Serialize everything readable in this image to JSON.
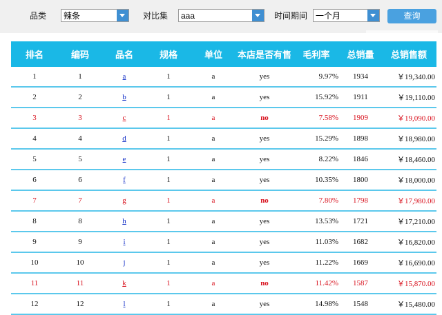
{
  "filters": {
    "category_label": "品类",
    "category_value": "辣条",
    "compare_label": "对比集",
    "compare_value": "aaa",
    "period_label": "时间期间",
    "period_value": "一个月",
    "query_label": "查询"
  },
  "table": {
    "headers": [
      "排名",
      "编码",
      "品名",
      "规格",
      "单位",
      "本店是否有售",
      "毛利率",
      "总销量",
      "总销售额"
    ],
    "rows": [
      {
        "rank": "1",
        "code": "1",
        "name": "a",
        "spec": "1",
        "unit": "a",
        "sale": "yes",
        "margin": "9.97%",
        "qty": "1934",
        "amount": "￥19,340.00",
        "warn": false
      },
      {
        "rank": "2",
        "code": "2",
        "name": "b",
        "spec": "1",
        "unit": "a",
        "sale": "yes",
        "margin": "15.92%",
        "qty": "1911",
        "amount": "￥19,110.00",
        "warn": false
      },
      {
        "rank": "3",
        "code": "3",
        "name": "c",
        "spec": "1",
        "unit": "a",
        "sale": "no",
        "margin": "7.58%",
        "qty": "1909",
        "amount": "￥19,090.00",
        "warn": true
      },
      {
        "rank": "4",
        "code": "4",
        "name": "d",
        "spec": "1",
        "unit": "a",
        "sale": "yes",
        "margin": "15.29%",
        "qty": "1898",
        "amount": "￥18,980.00",
        "warn": false
      },
      {
        "rank": "5",
        "code": "5",
        "name": "e",
        "spec": "1",
        "unit": "a",
        "sale": "yes",
        "margin": "8.22%",
        "qty": "1846",
        "amount": "￥18,460.00",
        "warn": false
      },
      {
        "rank": "6",
        "code": "6",
        "name": "f",
        "spec": "1",
        "unit": "a",
        "sale": "yes",
        "margin": "10.35%",
        "qty": "1800",
        "amount": "￥18,000.00",
        "warn": false
      },
      {
        "rank": "7",
        "code": "7",
        "name": "g",
        "spec": "1",
        "unit": "a",
        "sale": "no",
        "margin": "7.80%",
        "qty": "1798",
        "amount": "￥17,980.00",
        "warn": true
      },
      {
        "rank": "8",
        "code": "8",
        "name": "h",
        "spec": "1",
        "unit": "a",
        "sale": "yes",
        "margin": "13.53%",
        "qty": "1721",
        "amount": "￥17,210.00",
        "warn": false
      },
      {
        "rank": "9",
        "code": "9",
        "name": "i",
        "spec": "1",
        "unit": "a",
        "sale": "yes",
        "margin": "11.03%",
        "qty": "1682",
        "amount": "￥16,820.00",
        "warn": false
      },
      {
        "rank": "10",
        "code": "10",
        "name": "j",
        "spec": "1",
        "unit": "a",
        "sale": "yes",
        "margin": "11.22%",
        "qty": "1669",
        "amount": "￥16,690.00",
        "warn": false
      },
      {
        "rank": "11",
        "code": "11",
        "name": "k",
        "spec": "1",
        "unit": "a",
        "sale": "no",
        "margin": "11.42%",
        "qty": "1587",
        "amount": "￥15,870.00",
        "warn": true
      },
      {
        "rank": "12",
        "code": "12",
        "name": "l",
        "spec": "1",
        "unit": "a",
        "sale": "yes",
        "margin": "14.98%",
        "qty": "1548",
        "amount": "￥15,480.00",
        "warn": false
      }
    ]
  },
  "colors": {
    "header_bg": "#1ab8e6",
    "row_border": "#5bc8ec",
    "warn_text": "#d8101c",
    "link_text": "#1a35c9",
    "button_bg": "#4aa1e0"
  }
}
